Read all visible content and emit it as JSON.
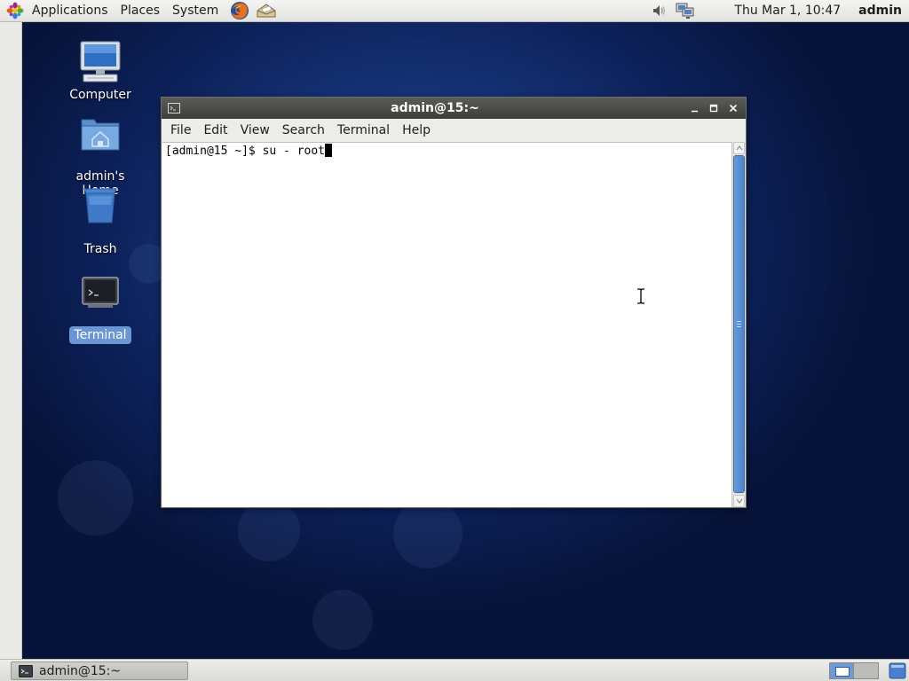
{
  "top_panel": {
    "menus": [
      "Applications",
      "Places",
      "System"
    ],
    "clock": "Thu Mar  1, 10:47",
    "user": "admin",
    "launchers": [
      "firefox-icon",
      "email-client-icon"
    ],
    "tray": [
      "volume-icon",
      "network-icon"
    ]
  },
  "desktop": {
    "icons": [
      {
        "label": "Computer",
        "icon": "computer-icon"
      },
      {
        "label": "admin's Home",
        "icon": "home-folder-icon"
      },
      {
        "label": "Trash",
        "icon": "trash-icon"
      },
      {
        "label": "Terminal",
        "icon": "terminal-icon",
        "selected": true
      }
    ]
  },
  "terminal_window": {
    "title": "admin@15:~",
    "menus": [
      "File",
      "Edit",
      "View",
      "Search",
      "Terminal",
      "Help"
    ],
    "prompt_line": "[admin@15 ~]$ su - root"
  },
  "bottom_panel": {
    "task_label": "admin@15:~",
    "workspaces": 2,
    "active_workspace": 1
  },
  "colors": {
    "desktop_bg": "#163478",
    "titlebar": "#4a4a47",
    "selection": "#6a96d4",
    "scroll_thumb": "#5a8ed2"
  }
}
